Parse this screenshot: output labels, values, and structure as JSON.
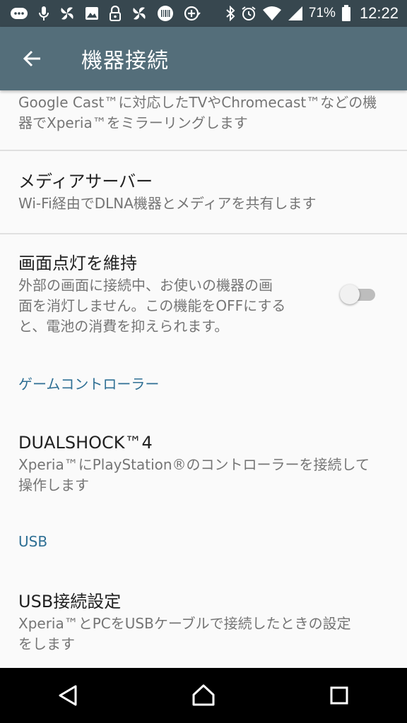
{
  "status_bar": {
    "battery_percent": "71%",
    "time": "12:22",
    "icons": [
      "message-icon",
      "mic-icon",
      "fan-icon",
      "image-icon",
      "lock-icon",
      "fan-icon",
      "barcode-icon",
      "add-circle-icon",
      "bluetooth-icon",
      "alarm-icon",
      "wifi-icon",
      "signal-icon",
      "battery-icon"
    ]
  },
  "app_bar": {
    "title": "機器接続",
    "back_icon": "arrow-back-icon"
  },
  "items": [
    {
      "summary": [
        "Google Cast™に対応したTVやChromecast™などの機",
        "器でXperia™をミラーリングします"
      ]
    },
    {
      "title": "メディアサーバー",
      "summary": [
        "Wi-Fi経由でDLNA機器とメディアを共有します"
      ]
    },
    {
      "title": "画面点灯を維持",
      "summary": [
        "外部の画面に接続中、お使いの機器の画",
        "面を消灯しません。この機能をOFFにする",
        "と、電池の消費を抑えられます。"
      ],
      "toggle_on": false
    }
  ],
  "game_category": "ゲームコントローラー",
  "dualshock": {
    "title": "DUALSHOCK™4",
    "summary": [
      "Xperia™にPlayStation®のコントローラーを接続して",
      "操作します"
    ]
  },
  "usb_category": "USB",
  "usb": {
    "title": "USB接続設定",
    "summary": [
      "Xperia™とPCをUSBケーブルで接続したときの設定",
      "をします"
    ]
  },
  "nav_bar": {
    "icons": [
      "back-triangle-icon",
      "home-icon",
      "recents-icon"
    ]
  },
  "colors": {
    "status_bar": "#37474f",
    "app_bar": "#546e7a",
    "category_text": "#2e6f94",
    "background": "#fafafa"
  }
}
